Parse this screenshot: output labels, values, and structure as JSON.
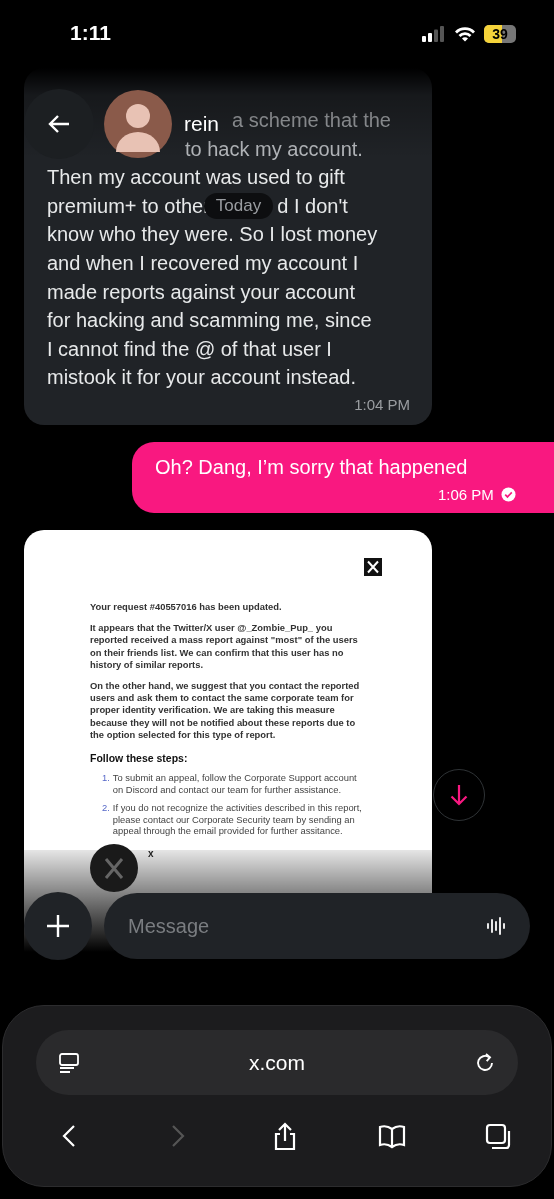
{
  "status_bar": {
    "time": "1:11",
    "battery": "39"
  },
  "header": {
    "name": "rein"
  },
  "messages": [
    {
      "kind": "received",
      "lines": [
        {
          "text": "a scheme that the"
        },
        {
          "text": "to hack my account."
        },
        {
          "text": "Then my account was used to gift"
        },
        {
          "text": "premium+ to other",
          "after": "d I don't"
        },
        {
          "text": "know who they were. So I lost money"
        },
        {
          "text": "and when I recovered my account I"
        },
        {
          "text": "made reports against your account"
        },
        {
          "text": "for hacking and scamming me, since"
        },
        {
          "text": "I cannot find the @ of that user I"
        },
        {
          "text": "mistook it for your account instead."
        }
      ],
      "time": "1:04 PM"
    },
    {
      "kind": "sent",
      "text": "Oh? Dang, I’m sorry that happened",
      "time": "1:06 PM",
      "read": true
    },
    {
      "kind": "image",
      "document": {
        "paragraphs": [
          "Your request **#40557016** has been updated.",
          "It appears that the Twitter/X user @**_Zombie_Pup_** you reported received a mass report against \"most\" of the users on their friends list. We can confirm that this user has no history of similar reports.",
          "On the other hand, we suggest that you contact the reported users and ask them to contact the same corporate team for proper identity verification. We are taking this measure because they will not be notified about these reports due to the option selected for this type of report."
        ],
        "heading": "Follow these steps:",
        "steps": [
          {
            "number": "1.",
            "text": "To submit an appeal, follow the Corporate Support account on Discord and contact our team for further assistance."
          },
          {
            "number": "2.",
            "text": "If you do not recognize the activities described in this report, please contact our Corporate Security team by sending an appeal through the email provided for further assitance."
          }
        ],
        "signature": "x"
      }
    }
  ],
  "day_divider": "Today",
  "composer": {
    "placeholder": "Message"
  },
  "browser": {
    "url": "x.com",
    "nav": [
      {
        "kind": "back",
        "disabled": false
      },
      {
        "kind": "forward",
        "disabled": true
      },
      {
        "kind": "share",
        "disabled": false
      },
      {
        "kind": "bookmarks",
        "disabled": false
      },
      {
        "kind": "tabs",
        "disabled": false
      }
    ]
  }
}
